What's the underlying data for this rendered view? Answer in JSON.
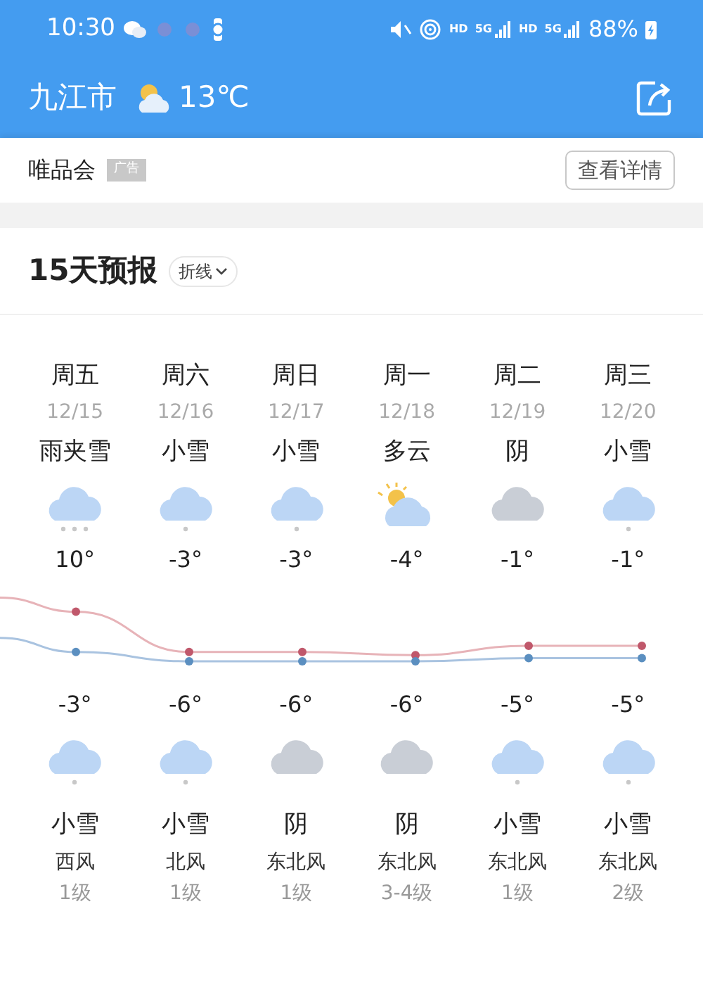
{
  "status_bar": {
    "time": "10:30",
    "network_labels": [
      "HD",
      "5G",
      "HD",
      "5G"
    ],
    "battery": "88%"
  },
  "header": {
    "city": "九江市",
    "temperature": "13℃"
  },
  "ad": {
    "brand": "唯品会",
    "tag": "广告",
    "button": "查看详情"
  },
  "forecast": {
    "title": "15天预报",
    "mode": "折线",
    "days": [
      {
        "weekday": "周五",
        "date": "12/15",
        "day_condition": "雨夹雪",
        "day_icon": {
          "kind": "sleet"
        },
        "high": "10°",
        "low": "-3°",
        "night_icon": {
          "kind": "snow"
        },
        "night_condition": "小雪",
        "wind": "西风",
        "wind_level": "1级"
      },
      {
        "weekday": "周六",
        "date": "12/16",
        "day_condition": "小雪",
        "day_icon": {
          "kind": "snow"
        },
        "high": "-3°",
        "low": "-6°",
        "night_icon": {
          "kind": "snow"
        },
        "night_condition": "小雪",
        "wind": "北风",
        "wind_level": "1级"
      },
      {
        "weekday": "周日",
        "date": "12/17",
        "day_condition": "小雪",
        "day_icon": {
          "kind": "snow"
        },
        "high": "-3°",
        "low": "-6°",
        "night_icon": {
          "kind": "overcast"
        },
        "night_condition": "阴",
        "wind": "东北风",
        "wind_level": "1级"
      },
      {
        "weekday": "周一",
        "date": "12/18",
        "day_condition": "多云",
        "day_icon": {
          "kind": "partly_cloudy"
        },
        "high": "-4°",
        "low": "-6°",
        "night_icon": {
          "kind": "overcast"
        },
        "night_condition": "阴",
        "wind": "东北风",
        "wind_level": "3-4级"
      },
      {
        "weekday": "周二",
        "date": "12/19",
        "day_condition": "阴",
        "day_icon": {
          "kind": "overcast"
        },
        "high": "-1°",
        "low": "-5°",
        "night_icon": {
          "kind": "snow"
        },
        "night_condition": "小雪",
        "wind": "东北风",
        "wind_level": "1级"
      },
      {
        "weekday": "周三",
        "date": "12/20",
        "day_condition": "小雪",
        "day_icon": {
          "kind": "snow"
        },
        "high": "-1°",
        "low": "-5°",
        "night_icon": {
          "kind": "snow"
        },
        "night_condition": "小雪",
        "wind": "东北风",
        "wind_level": "2级"
      }
    ]
  }
}
